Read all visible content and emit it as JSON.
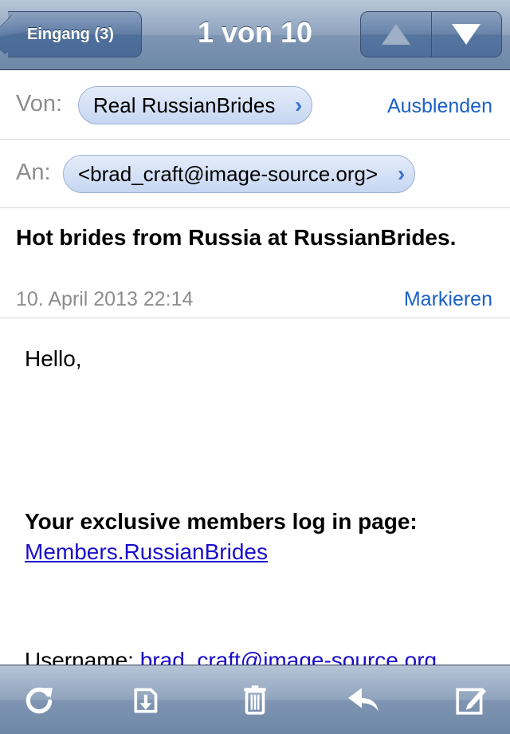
{
  "nav": {
    "back_label": "Eingang (3)",
    "title": "1 von 10",
    "prev_icon": "arrow-up-icon",
    "next_icon": "arrow-down-icon"
  },
  "header": {
    "from_label": "Von:",
    "from_value": "Real RussianBrides",
    "hide_label": "Ausblenden",
    "to_label": "An:",
    "to_value": "<brad_craft@image-source.org>",
    "subject": "Hot brides from Russia at RussianBrides.",
    "date": "10. April 2013 22:14",
    "flag_label": "Markieren"
  },
  "body": {
    "greeting": "Hello,",
    "members_heading": "Your exclusive members log in page:",
    "members_link": "Members.RussianBrides",
    "username_label": "Username:",
    "username_value": "brad_craft@image-source.org"
  },
  "toolbar": {
    "items": [
      "refresh-icon",
      "move-to-folder-icon",
      "trash-icon",
      "reply-icon",
      "compose-icon"
    ]
  }
}
